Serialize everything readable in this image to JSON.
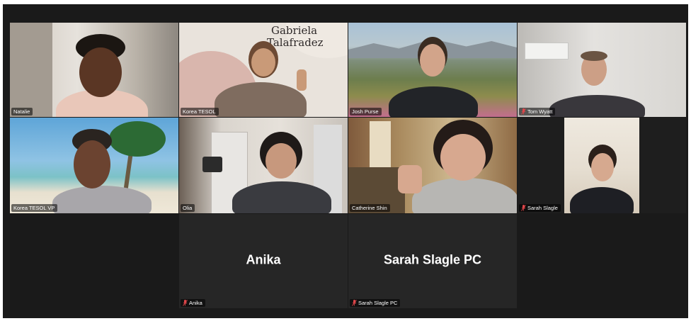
{
  "meeting": {
    "participants": [
      {
        "id": "natalie",
        "name": "Natalie",
        "muted": false,
        "video": true
      },
      {
        "id": "korea-tesol",
        "name": "Korea TESOL",
        "muted": false,
        "video": true,
        "active_speaker": true,
        "background_text": [
          "Gabriela",
          "Talafradez"
        ]
      },
      {
        "id": "josh",
        "name": "Josh Purse",
        "muted": false,
        "video": true
      },
      {
        "id": "tom",
        "name": "Tom Wyatt",
        "muted": true,
        "video": true
      },
      {
        "id": "kvp",
        "name": "Korea TESOL VP",
        "muted": false,
        "video": true
      },
      {
        "id": "olia",
        "name": "Olia",
        "muted": false,
        "video": true
      },
      {
        "id": "catherine",
        "name": "Catherine Shin",
        "muted": false,
        "video": true
      },
      {
        "id": "sarah",
        "name": "Sarah Slagle",
        "muted": true,
        "video": true
      },
      {
        "id": "anika",
        "name": "Anika",
        "muted": true,
        "video": false,
        "display_name": "Anika"
      },
      {
        "id": "sarah-pc",
        "name": "Sarah Slagle PC",
        "muted": true,
        "video": false,
        "display_name": "Sarah Slagle PC"
      }
    ]
  },
  "colors": {
    "background": "#1a1a1a",
    "tile_empty": "#262626",
    "active_speaker_border": "#23d18b",
    "muted_icon": "#e0464a"
  }
}
